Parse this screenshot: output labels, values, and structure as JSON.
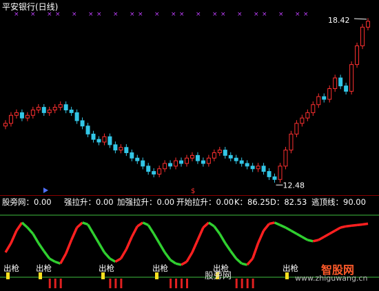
{
  "title": "平安银行(日线)",
  "chart_data": [
    {
      "type": "candlestick",
      "title": "平安银行(日线)",
      "annotations": {
        "high_label": "18.42",
        "low_label": "12.48"
      },
      "colors": {
        "up": "#ff3030",
        "down": "#33c6e6",
        "marker": "#c040ff"
      },
      "approx_close_series": [
        14.6,
        14.9,
        15.0,
        14.8,
        14.9,
        15.1,
        15.2,
        15.0,
        15.1,
        15.2,
        15.3,
        15.1,
        15.0,
        14.7,
        14.5,
        14.2,
        14.0,
        13.9,
        14.1,
        13.8,
        13.6,
        13.7,
        13.5,
        13.3,
        13.2,
        13.0,
        12.8,
        12.7,
        12.9,
        13.1,
        13.0,
        13.2,
        13.1,
        13.3,
        13.4,
        13.2,
        13.1,
        13.3,
        13.5,
        13.6,
        13.4,
        13.3,
        13.2,
        13.1,
        13.0,
        12.9,
        13.0,
        12.8,
        12.6,
        12.5,
        13.0,
        13.6,
        14.2,
        14.6,
        14.8,
        15.0,
        15.3,
        15.6,
        15.5,
        15.9,
        16.3,
        16.0,
        15.8,
        16.8,
        17.5,
        18.2,
        18.42
      ]
    },
    {
      "type": "indicator",
      "legend": [
        {
          "text": "股旁网：0.00",
          "color": "#ffffff"
        },
        {
          "text": "强拉升：0.00",
          "color": "#ffffff"
        },
        {
          "text": "加强拉升：0.00",
          "color": "#ff40ff"
        },
        {
          "text": "开始拉升：0.00",
          "color": "#ff3030"
        },
        {
          "text": "K：86.25",
          "color": "#ffffff"
        },
        {
          "text": "D：82.53",
          "color": "#3050ff"
        },
        {
          "text": "逃顶线：90.00",
          "color": "#40ff40"
        }
      ],
      "signals": [
        "出枪",
        "出枪",
        "出枪",
        "出枪",
        "出枪",
        "出枪"
      ],
      "k_series": [
        40,
        55,
        75,
        88,
        80,
        70,
        55,
        42,
        30,
        25,
        22,
        38,
        60,
        80,
        88,
        85,
        70,
        55,
        40,
        30,
        25,
        30,
        45,
        65,
        82,
        88,
        84,
        70,
        55,
        40,
        28,
        22,
        20,
        25,
        40,
        60,
        80,
        88,
        82,
        70,
        55,
        42,
        30,
        22,
        20,
        30,
        55,
        75,
        86,
        88,
        84,
        80,
        75,
        70,
        65,
        60,
        58,
        60,
        65,
        70,
        75,
        80,
        82,
        83,
        84,
        85,
        86.25
      ]
    }
  ],
  "watermarks": [
    "股旁网",
    "智股网",
    "www.zhiguwang.cn"
  ]
}
